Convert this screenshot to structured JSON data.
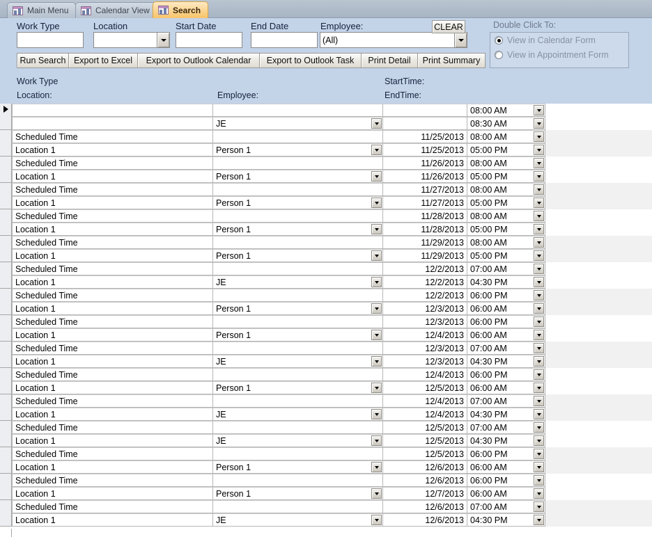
{
  "window": {
    "tabs": [
      {
        "label": "Main Menu",
        "icon": "access-form-icon",
        "active": false
      },
      {
        "label": "Calendar View",
        "icon": "access-form-icon",
        "active": false
      },
      {
        "label": "Search",
        "icon": "access-form-icon",
        "active": true
      }
    ]
  },
  "search_form": {
    "work_type": {
      "label": "Work Type",
      "value": "",
      "placeholder": ""
    },
    "location": {
      "label": "Location",
      "value": "",
      "placeholder": ""
    },
    "start_date": {
      "label": "Start Date",
      "value": "",
      "placeholder": ""
    },
    "end_date": {
      "label": "End Date",
      "value": "",
      "placeholder": ""
    },
    "employee": {
      "label": "Employee:",
      "value": "(All)"
    },
    "clear_button": "CLEAR",
    "buttons": [
      "Run Search",
      "Export to Excel",
      "Export to Outlook Calendar",
      "Export to Outlook Task",
      "Print Detail",
      "Print Summary"
    ],
    "double_click_group": {
      "caption": "Double Click To:",
      "options": [
        {
          "label": "View in Calendar Form",
          "selected": true
        },
        {
          "label": "View in Appointment Form",
          "selected": false
        }
      ]
    }
  },
  "datasheet": {
    "headers": {
      "work_type": "Work Type",
      "location": "Location:",
      "employee": "Employee:",
      "start_time": "StartTime:",
      "end_time": "EndTime:"
    },
    "records": [
      {
        "selected": true,
        "shade": "plain",
        "row1": {
          "work_type": "",
          "employee": "",
          "employee_combo": false,
          "date": "",
          "time": "08:00 AM"
        },
        "row2": {
          "location": "",
          "employee": "JE",
          "employee_combo": true,
          "date": "",
          "time": "08:30 AM"
        }
      },
      {
        "selected": false,
        "shade": "alt",
        "row1": {
          "work_type": "Scheduled Time",
          "employee": "",
          "employee_combo": false,
          "date": "11/25/2013",
          "time": "08:00 AM"
        },
        "row2": {
          "location": "Location 1",
          "employee": "Person 1",
          "employee_combo": true,
          "date": "11/25/2013",
          "time": "05:00 PM"
        }
      },
      {
        "selected": false,
        "shade": "plain",
        "row1": {
          "work_type": "Scheduled Time",
          "employee": "",
          "employee_combo": false,
          "date": "11/26/2013",
          "time": "08:00 AM"
        },
        "row2": {
          "location": "Location 1",
          "employee": "Person 1",
          "employee_combo": true,
          "date": "11/26/2013",
          "time": "05:00 PM"
        }
      },
      {
        "selected": false,
        "shade": "alt",
        "row1": {
          "work_type": "Scheduled Time",
          "employee": "",
          "employee_combo": false,
          "date": "11/27/2013",
          "time": "08:00 AM"
        },
        "row2": {
          "location": "Location 1",
          "employee": "Person 1",
          "employee_combo": true,
          "date": "11/27/2013",
          "time": "05:00 PM"
        }
      },
      {
        "selected": false,
        "shade": "plain",
        "row1": {
          "work_type": "Scheduled Time",
          "employee": "",
          "employee_combo": false,
          "date": "11/28/2013",
          "time": "08:00 AM"
        },
        "row2": {
          "location": "Location 1",
          "employee": "Person 1",
          "employee_combo": true,
          "date": "11/28/2013",
          "time": "05:00 PM"
        }
      },
      {
        "selected": false,
        "shade": "alt",
        "row1": {
          "work_type": "Scheduled Time",
          "employee": "",
          "employee_combo": false,
          "date": "11/29/2013",
          "time": "08:00 AM"
        },
        "row2": {
          "location": "Location 1",
          "employee": "Person 1",
          "employee_combo": true,
          "date": "11/29/2013",
          "time": "05:00 PM"
        }
      },
      {
        "selected": false,
        "shade": "plain",
        "row1": {
          "work_type": "Scheduled Time",
          "employee": "",
          "employee_combo": false,
          "date": "12/2/2013",
          "time": "07:00 AM"
        },
        "row2": {
          "location": "Location 1",
          "employee": "JE",
          "employee_combo": true,
          "date": "12/2/2013",
          "time": "04:30 PM"
        }
      },
      {
        "selected": false,
        "shade": "alt",
        "row1": {
          "work_type": "Scheduled Time",
          "employee": "",
          "employee_combo": false,
          "date": "12/2/2013",
          "time": "06:00 PM"
        },
        "row2": {
          "location": "Location 1",
          "employee": "Person 1",
          "employee_combo": true,
          "date": "12/3/2013",
          "time": "06:00 AM"
        }
      },
      {
        "selected": false,
        "shade": "plain",
        "row1": {
          "work_type": "Scheduled Time",
          "employee": "",
          "employee_combo": false,
          "date": "12/3/2013",
          "time": "06:00 PM"
        },
        "row2": {
          "location": "Location 1",
          "employee": "Person 1",
          "employee_combo": true,
          "date": "12/4/2013",
          "time": "06:00 AM"
        }
      },
      {
        "selected": false,
        "shade": "alt",
        "row1": {
          "work_type": "Scheduled Time",
          "employee": "",
          "employee_combo": false,
          "date": "12/3/2013",
          "time": "07:00 AM"
        },
        "row2": {
          "location": "Location 1",
          "employee": "JE",
          "employee_combo": true,
          "date": "12/3/2013",
          "time": "04:30 PM"
        }
      },
      {
        "selected": false,
        "shade": "plain",
        "row1": {
          "work_type": "Scheduled Time",
          "employee": "",
          "employee_combo": false,
          "date": "12/4/2013",
          "time": "06:00 PM"
        },
        "row2": {
          "location": "Location 1",
          "employee": "Person 1",
          "employee_combo": true,
          "date": "12/5/2013",
          "time": "06:00 AM"
        }
      },
      {
        "selected": false,
        "shade": "alt",
        "row1": {
          "work_type": "Scheduled Time",
          "employee": "",
          "employee_combo": false,
          "date": "12/4/2013",
          "time": "07:00 AM"
        },
        "row2": {
          "location": "Location 1",
          "employee": "JE",
          "employee_combo": true,
          "date": "12/4/2013",
          "time": "04:30 PM"
        }
      },
      {
        "selected": false,
        "shade": "plain",
        "row1": {
          "work_type": "Scheduled Time",
          "employee": "",
          "employee_combo": false,
          "date": "12/5/2013",
          "time": "07:00 AM"
        },
        "row2": {
          "location": "Location 1",
          "employee": "JE",
          "employee_combo": true,
          "date": "12/5/2013",
          "time": "04:30 PM"
        }
      },
      {
        "selected": false,
        "shade": "alt",
        "row1": {
          "work_type": "Scheduled Time",
          "employee": "",
          "employee_combo": false,
          "date": "12/5/2013",
          "time": "06:00 PM"
        },
        "row2": {
          "location": "Location 1",
          "employee": "Person 1",
          "employee_combo": true,
          "date": "12/6/2013",
          "time": "06:00 AM"
        }
      },
      {
        "selected": false,
        "shade": "plain",
        "row1": {
          "work_type": "Scheduled Time",
          "employee": "",
          "employee_combo": false,
          "date": "12/6/2013",
          "time": "06:00 PM"
        },
        "row2": {
          "location": "Location 1",
          "employee": "Person 1",
          "employee_combo": true,
          "date": "12/7/2013",
          "time": "06:00 AM"
        }
      },
      {
        "selected": false,
        "shade": "alt",
        "row1": {
          "work_type": "Scheduled Time",
          "employee": "",
          "employee_combo": false,
          "date": "12/6/2013",
          "time": "07:00 AM"
        },
        "row2": {
          "location": "Location 1",
          "employee": "JE",
          "employee_combo": true,
          "date": "12/6/2013",
          "time": "04:30 PM"
        }
      }
    ]
  },
  "colors": {
    "header_background": "#c3d3e8",
    "tabstrip_background": "#b0bcc9",
    "active_tab": "#f7c368",
    "alt_row": "#f1f1f1",
    "grid_line": "#b6b6b6"
  }
}
